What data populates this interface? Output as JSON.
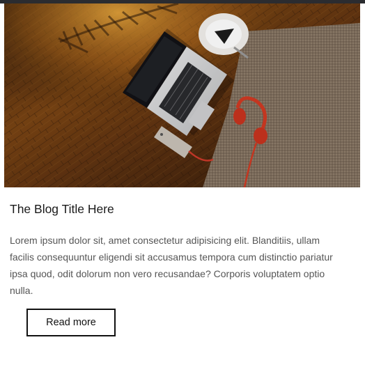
{
  "post": {
    "image_alt": "Laptop, phone, headphones and a coffee cup on a wooden floor next to a rug",
    "title": "The Blog Title Here",
    "excerpt": "Lorem ipsum dolor sit, amet consectetur adipisicing elit. Blanditiis, ullam facilis consequuntur eligendi sit accusamus tempora cum distinctio pariatur ipsa quod, odit dolorum non vero recusandae? Corporis voluptatem optio nulla.",
    "read_more_label": "Read more"
  },
  "colors": {
    "topbar": "#2b2c30",
    "title": "#1a1a1a",
    "excerpt": "#555555",
    "button_border": "#111111"
  }
}
